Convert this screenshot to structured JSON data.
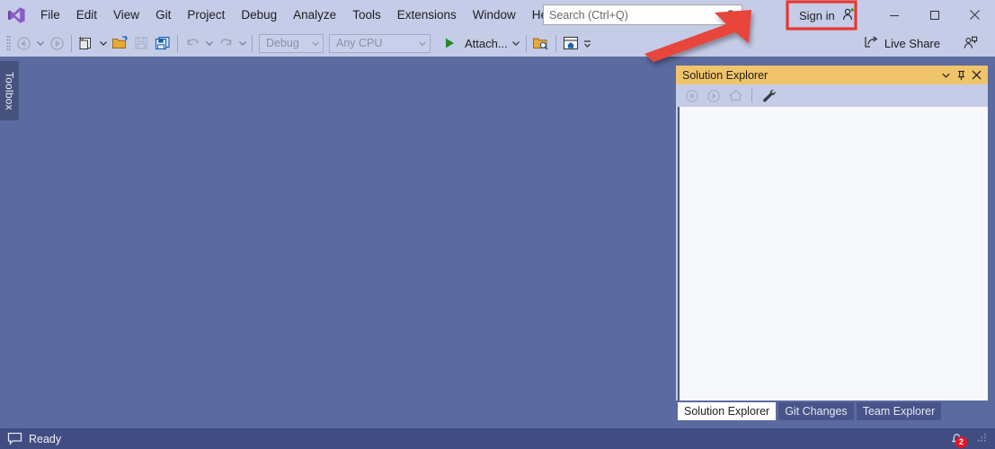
{
  "window": {
    "app": "Visual Studio",
    "logo_icon": "visual-studio-logo"
  },
  "menubar": {
    "items": [
      {
        "label": "File"
      },
      {
        "label": "Edit"
      },
      {
        "label": "View"
      },
      {
        "label": "Git"
      },
      {
        "label": "Project"
      },
      {
        "label": "Debug"
      },
      {
        "label": "Analyze"
      },
      {
        "label": "Tools"
      },
      {
        "label": "Extensions"
      },
      {
        "label": "Window"
      },
      {
        "label": "Help"
      }
    ]
  },
  "search": {
    "placeholder": "Search (Ctrl+Q)",
    "value": "",
    "icon": "magnifier-icon"
  },
  "titlebar": {
    "signin_label": "Sign in",
    "signin_icon": "add-person-icon",
    "minimize_icon": "minimize-icon",
    "maximize_icon": "maximize-icon",
    "close_icon": "close-icon"
  },
  "toolbar": {
    "nav_back_icon": "navigate-back-icon",
    "nav_forward_icon": "navigate-forward-icon",
    "new_project_icon": "new-project-icon",
    "open_file_icon": "open-file-icon",
    "save_icon": "save-icon",
    "save_all_icon": "save-all-icon",
    "undo_icon": "undo-icon",
    "redo_icon": "redo-icon",
    "config_combo": "Debug",
    "platform_combo": "Any CPU",
    "attach_label": "Attach...",
    "attach_icon": "run-play-icon",
    "find_in_files_icon": "find-in-files-icon",
    "window_home_icon": "window-home-icon",
    "overflow_icon": "toolbar-overflow-icon",
    "live_share_label": "Live Share",
    "live_share_icon": "live-share-icon",
    "feedback_icon": "send-feedback-icon"
  },
  "toolbox": {
    "label": "Toolbox"
  },
  "solution_explorer": {
    "title": "Solution Explorer",
    "dropdown_icon": "chevron-down-icon",
    "pin_icon": "pin-icon",
    "close_icon": "close-icon",
    "toolbar": {
      "back_icon": "back-circle-icon",
      "forward_icon": "forward-circle-icon",
      "home_icon": "home-icon",
      "properties_icon": "wrench-icon"
    },
    "tabs": [
      {
        "label": "Solution Explorer",
        "active": true
      },
      {
        "label": "Git Changes",
        "active": false
      },
      {
        "label": "Team Explorer",
        "active": false
      }
    ]
  },
  "statusbar": {
    "icon": "notification-balloon-icon",
    "text": "Ready",
    "bell_icon": "bell-icon",
    "bell_count": "2",
    "grip_icon": "resize-grip-icon"
  },
  "annotation": {
    "highlight_color": "#E8382F",
    "arrow_color": "#E8453C",
    "target": "Sign in"
  },
  "colors": {
    "title_bar": "#C5CCE8",
    "workspace": "#5B6AA0",
    "panel_header_active": "#EFC46A",
    "status_bar": "#414D82",
    "accent_purple": "#8A5CC4"
  }
}
